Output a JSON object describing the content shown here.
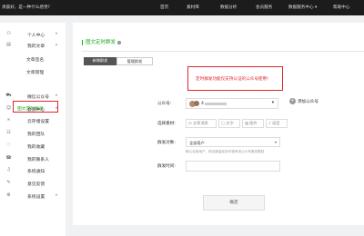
{
  "topbar": {
    "greeting": "清晨好，是一种什么感觉?",
    "nav": [
      "首页",
      "素材库",
      "数据分析",
      "会员服务",
      "数据服务中心 ▾",
      "帮助中心"
    ]
  },
  "sidebar": {
    "items": [
      {
        "label": "个人中心",
        "icon": "person-icon",
        "glyph": "⚇",
        "arrow": "▾"
      },
      {
        "label": "我的文章",
        "icon": "document-icon",
        "glyph": "▤",
        "arrow": "▴"
      },
      {
        "label": "微信公众号",
        "icon": "cart-icon",
        "glyph": "⛟",
        "arrow": "▾"
      },
      {
        "label": "会员中心",
        "icon": "user-icon",
        "glyph": "☺",
        "arrow": "▾"
      },
      {
        "label": "云存储设置",
        "icon": "link-icon",
        "glyph": "∞",
        "arrow": ""
      },
      {
        "label": "我的团队",
        "icon": "team-icon",
        "glyph": "☷",
        "arrow": ""
      },
      {
        "label": "我的收藏",
        "icon": "heart-icon",
        "glyph": "♡",
        "arrow": ""
      },
      {
        "label": "我的联系人",
        "icon": "contact-icon",
        "glyph": "☎",
        "arrow": ""
      },
      {
        "label": "系统通知",
        "icon": "bell-icon",
        "glyph": "♫",
        "arrow": ""
      },
      {
        "label": "意见反馈",
        "icon": "feedback-icon",
        "glyph": "✎",
        "arrow": ""
      },
      {
        "label": "系统设置",
        "icon": "gear-icon",
        "glyph": "⚙",
        "arrow": "▾"
      }
    ],
    "subitems": [
      "文章签名",
      "文章管理"
    ],
    "active_subitem": "图文定时群发"
  },
  "main": {
    "title": "图文定时群发",
    "help_glyph": "?",
    "tabs": [
      "新增群发",
      "管理群发"
    ],
    "notice": "定时群发功能仅支持认证的公众号使用!",
    "form": {
      "account_label": "公众号:",
      "account_name": "4",
      "add_account": "添加公众号",
      "material_label": "选择素材:",
      "material_buttons": [
        "◷ 文章消息",
        "▢ 文字",
        "▨ 图片",
        "♪ 语音"
      ],
      "audience_label": "群发对象:",
      "audience_value": "全部用户",
      "audience_hint": "默认全部用户，粉丝数量较多时请考虑公众号服务限制",
      "time_label": "群发时间:",
      "submit": "确定"
    }
  },
  "colors": {
    "accent": "#1aad19",
    "alert": "#e0262d",
    "topbar": "#1c1c1c"
  }
}
